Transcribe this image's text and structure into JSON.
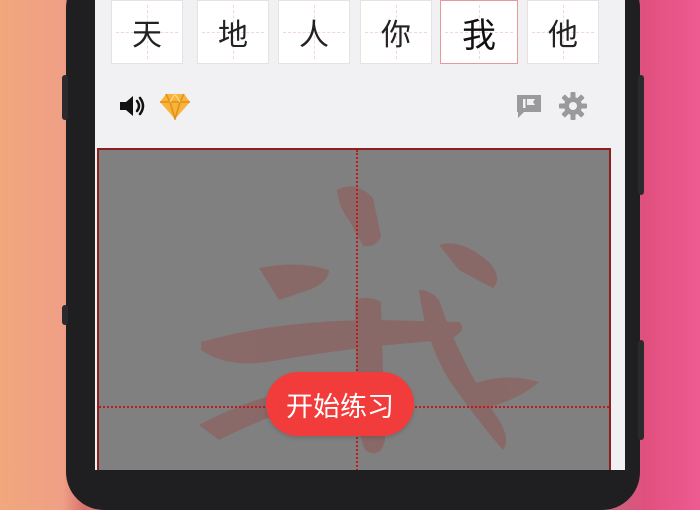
{
  "characters": [
    {
      "glyph": "天",
      "selected": false
    },
    {
      "glyph": "地",
      "selected": false
    },
    {
      "glyph": "人",
      "selected": false
    },
    {
      "glyph": "你",
      "selected": false
    },
    {
      "glyph": "我",
      "selected": true
    },
    {
      "glyph": "他",
      "selected": false
    }
  ],
  "toolbar": {
    "left_icons": [
      "speaker-icon",
      "diamond-icon"
    ],
    "right_icons": [
      "feedback-icon",
      "gear-icon"
    ]
  },
  "practice": {
    "start_label": "开始练习"
  },
  "colors": {
    "accent": "#f23c3b",
    "practice_border": "#8d1f1f",
    "guide": "#c21a1a",
    "practice_bg": "#808080"
  }
}
